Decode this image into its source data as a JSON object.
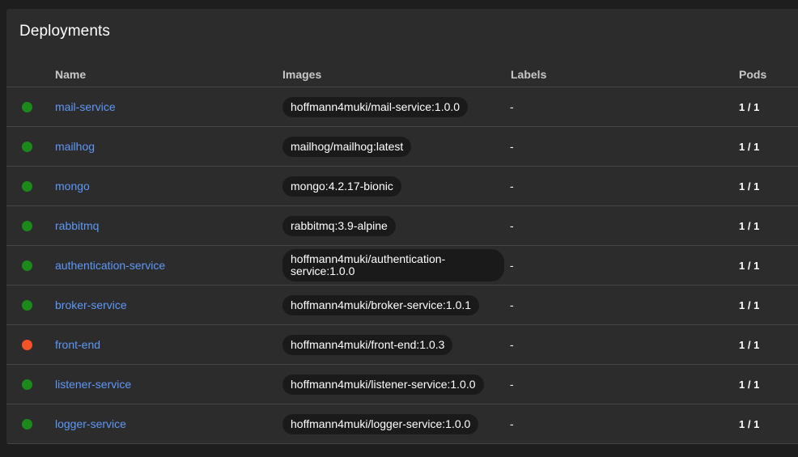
{
  "card": {
    "title": "Deployments"
  },
  "table": {
    "columns": {
      "name": "Name",
      "images": "Images",
      "labels": "Labels",
      "pods": "Pods"
    },
    "rows": [
      {
        "status": "running",
        "name": "mail-service",
        "image": "hoffmann4muki/mail-service:1.0.0",
        "labels": "-",
        "pods": "1 / 1"
      },
      {
        "status": "running",
        "name": "mailhog",
        "image": "mailhog/mailhog:latest",
        "labels": "-",
        "pods": "1 / 1"
      },
      {
        "status": "running",
        "name": "mongo",
        "image": "mongo:4.2.17-bionic",
        "labels": "-",
        "pods": "1 / 1"
      },
      {
        "status": "running",
        "name": "rabbitmq",
        "image": "rabbitmq:3.9-alpine",
        "labels": "-",
        "pods": "1 / 1"
      },
      {
        "status": "running",
        "name": "authentication-service",
        "image": "hoffmann4muki/authentication-service:1.0.0",
        "labels": "-",
        "pods": "1 / 1"
      },
      {
        "status": "running",
        "name": "broker-service",
        "image": "hoffmann4muki/broker-service:1.0.1",
        "labels": "-",
        "pods": "1 / 1"
      },
      {
        "status": "error",
        "name": "front-end",
        "image": "hoffmann4muki/front-end:1.0.3",
        "labels": "-",
        "pods": "1 / 1"
      },
      {
        "status": "running",
        "name": "listener-service",
        "image": "hoffmann4muki/listener-service:1.0.0",
        "labels": "-",
        "pods": "1 / 1"
      },
      {
        "status": "running",
        "name": "logger-service",
        "image": "hoffmann4muki/logger-service:1.0.0",
        "labels": "-",
        "pods": "1 / 1"
      }
    ]
  },
  "colors": {
    "background": "#1e1e1e",
    "card": "#2c2c2c",
    "link": "#5e97f6",
    "status_running": "#1b8a1b",
    "status_error": "#f45227",
    "chip": "#1a1a1a"
  }
}
